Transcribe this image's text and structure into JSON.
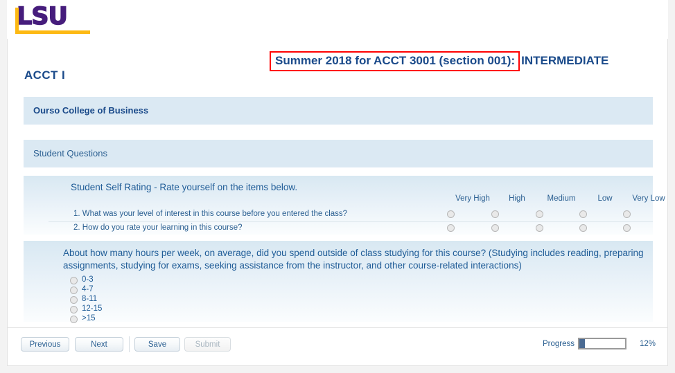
{
  "branding": {
    "logo_text": "LSU",
    "logo_purple": "#461d7c",
    "logo_gold": "#fdb913"
  },
  "header": {
    "title_highlighted": "Summer 2018 for ACCT 3001 (section 001):",
    "title_tail": "INTERMEDIATE",
    "title_line2": "ACCT I",
    "highlight_color": "#ff0000"
  },
  "bands": {
    "college": "Ourso College of Business",
    "student_questions": "Student Questions"
  },
  "rating_section": {
    "title": "Student Self Rating - Rate yourself on the items below.",
    "columns": [
      "Very High",
      "High",
      "Medium",
      "Low",
      "Very Low"
    ],
    "questions": [
      "1. What was your level of interest in this course before you entered the class?",
      "2. How do you rate your learning in this course?"
    ]
  },
  "hours_section": {
    "prompt": "About how many hours per week, on average, did you spend outside of class studying for this course? (Studying includes reading, preparing assignments, studying for exams, seeking assistance from the instructor, and other course-related interactions)",
    "options": [
      "0-3",
      "4-7",
      "8-11",
      "12-15",
      ">15"
    ]
  },
  "footer": {
    "previous": "Previous",
    "next": "Next",
    "save": "Save",
    "submit": "Submit",
    "progress_label": "Progress",
    "progress_percent_text": "12%",
    "progress_value": 12
  }
}
